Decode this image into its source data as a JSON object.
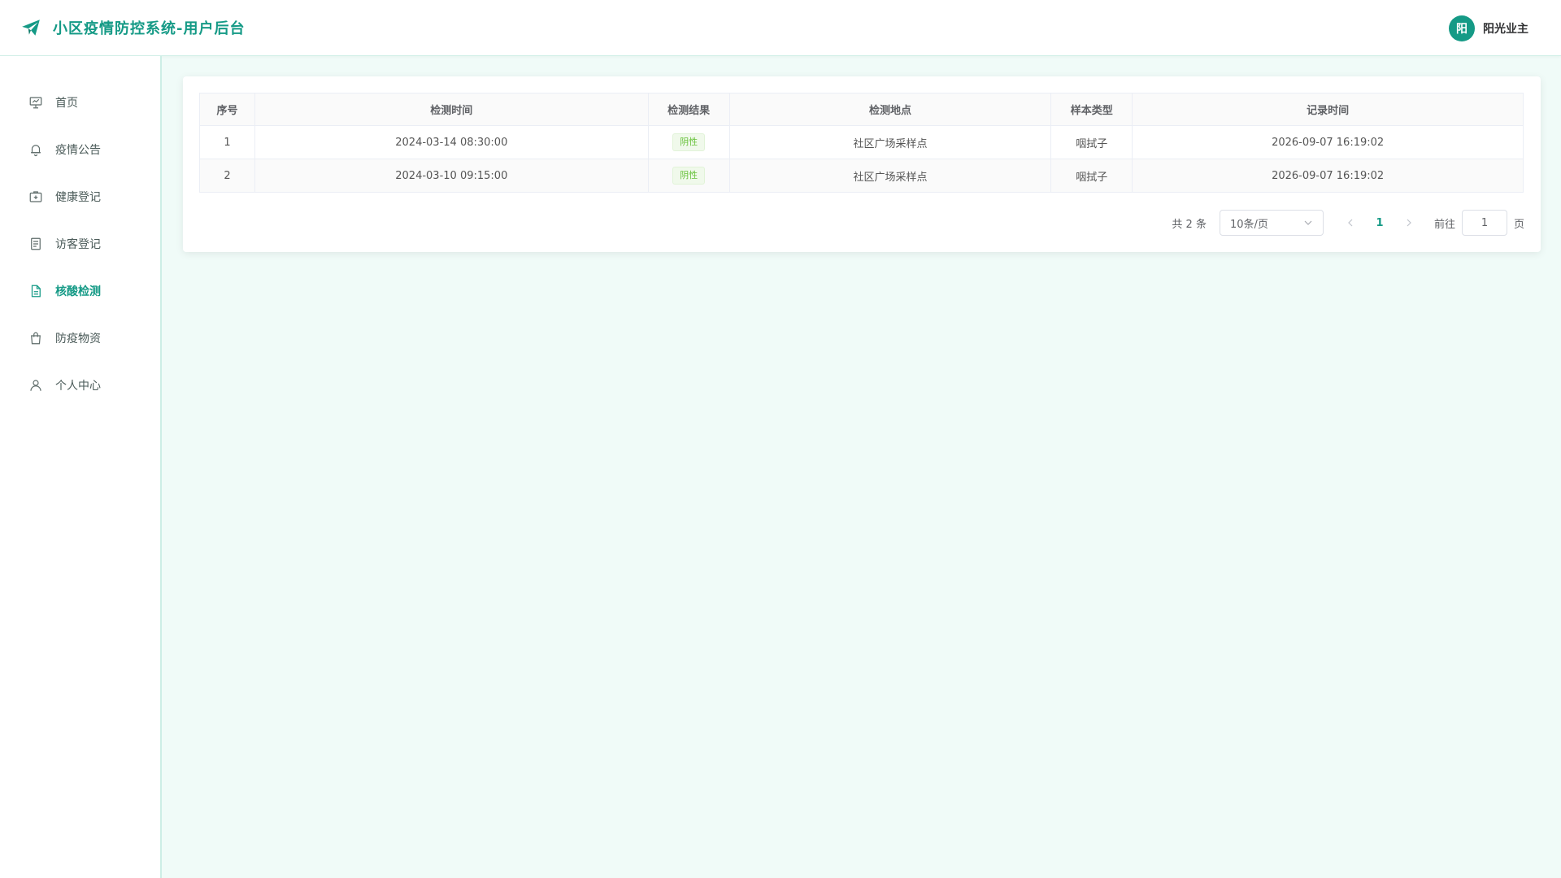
{
  "app": {
    "title": "小区疫情防控系统-用户后台",
    "accent_color": "#159a86",
    "logo_icon": "paper-plane-icon"
  },
  "user": {
    "avatar_text": "阳",
    "name": "阳光业主"
  },
  "sidebar": {
    "items": [
      {
        "label": "首页",
        "icon": "presentation-icon",
        "active": false
      },
      {
        "label": "疫情公告",
        "icon": "bell-icon",
        "active": false
      },
      {
        "label": "健康登记",
        "icon": "medical-box-icon",
        "active": false
      },
      {
        "label": "访客登记",
        "icon": "document-list-icon",
        "active": false
      },
      {
        "label": "核酸检测",
        "icon": "document-icon",
        "active": true
      },
      {
        "label": "防疫物资",
        "icon": "shopping-bag-icon",
        "active": false
      },
      {
        "label": "个人中心",
        "icon": "user-icon",
        "active": false
      }
    ]
  },
  "table": {
    "headers": [
      "序号",
      "检测时间",
      "检测结果",
      "检测地点",
      "样本类型",
      "记录时间"
    ],
    "rows": [
      {
        "index": "1",
        "test_time": "2024-03-14 08:30:00",
        "result": "阴性",
        "location": "社区广场采样点",
        "sample_type": "咽拭子",
        "record_time": "2026-09-07 16:19:02"
      },
      {
        "index": "2",
        "test_time": "2024-03-10 09:15:00",
        "result": "阴性",
        "location": "社区广场采样点",
        "sample_type": "咽拭子",
        "record_time": "2026-09-07 16:19:02"
      }
    ]
  },
  "pagination": {
    "total_text": "共 2 条",
    "page_size": "10条/页",
    "current_page": "1",
    "goto_label": "前往",
    "goto_value": "1",
    "page_suffix": "页"
  }
}
